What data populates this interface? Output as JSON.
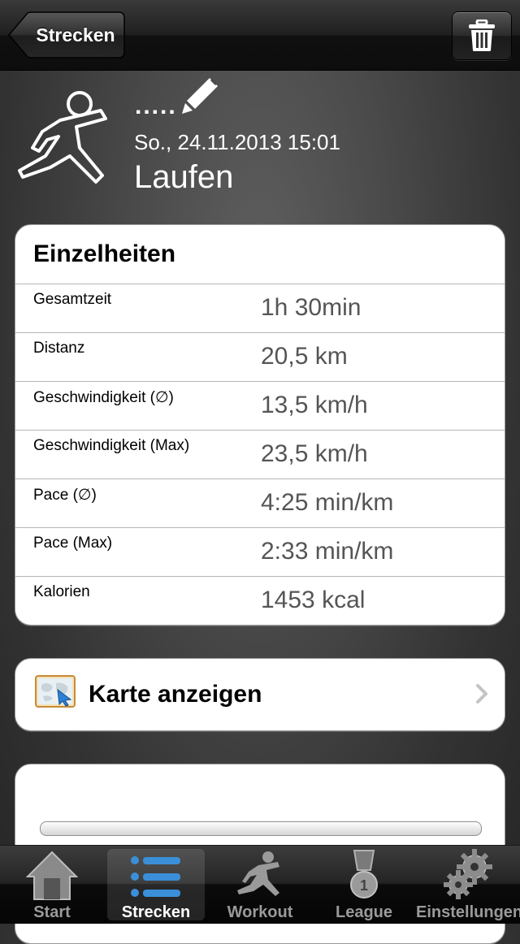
{
  "navbar": {
    "back_label": "Strecken"
  },
  "header": {
    "name": ".....",
    "date": "So., 24.11.2013 15:01",
    "activity_type": "Laufen"
  },
  "details": {
    "title": "Einzelheiten",
    "rows": [
      {
        "label": "Gesamtzeit",
        "value": "1h 30min"
      },
      {
        "label": "Distanz",
        "value": "20,5 km"
      },
      {
        "label": "Geschwindigkeit (∅)",
        "value": "13,5 km/h"
      },
      {
        "label": "Geschwindigkeit (Max)",
        "value": "23,5 km/h"
      },
      {
        "label": "Pace (∅)",
        "value": "4:25 min/km"
      },
      {
        "label": "Pace (Max)",
        "value": "2:33 min/km"
      },
      {
        "label": "Kalorien",
        "value": "1453 kcal"
      }
    ]
  },
  "map": {
    "label": "Karte anzeigen"
  },
  "tabs": [
    {
      "label": "Start",
      "icon": "home-icon",
      "active": false
    },
    {
      "label": "Strecken",
      "icon": "list-icon",
      "active": true
    },
    {
      "label": "Workout",
      "icon": "runner-icon",
      "active": false
    },
    {
      "label": "League",
      "icon": "medal-icon",
      "active": false
    },
    {
      "label": "Einstellungen",
      "icon": "gear-icon",
      "active": false
    }
  ],
  "colors": {
    "accent_blue": "#3b8fd9",
    "background": "#4a4a4a"
  }
}
